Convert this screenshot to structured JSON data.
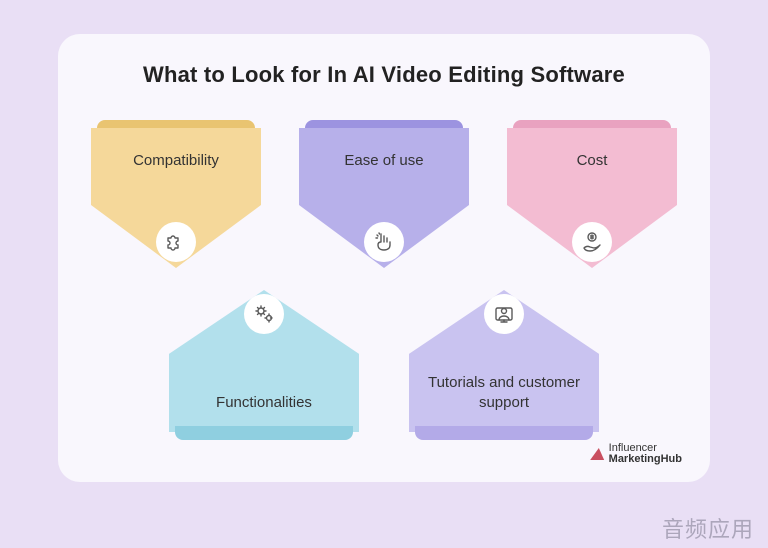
{
  "title": "What to Look for In AI Video Editing Software",
  "items": [
    {
      "label": "Compatibility",
      "icon": "puzzle-icon",
      "direction": "down",
      "color": "#f5d89a"
    },
    {
      "label": "Ease of use",
      "icon": "snap-icon",
      "direction": "down",
      "color": "#b7b0ea"
    },
    {
      "label": "Cost",
      "icon": "hand-coin-icon",
      "direction": "down",
      "color": "#f3bcd2"
    },
    {
      "label": "Functionalities",
      "icon": "gears-icon",
      "direction": "up",
      "color": "#b2e0ec"
    },
    {
      "label": "Tutorials and customer support",
      "icon": "support-agent-icon",
      "direction": "up",
      "color": "#c9c3f0"
    }
  ],
  "logo": {
    "line1": "Influencer",
    "line2": "MarketingHub"
  },
  "watermark": "音频应用"
}
